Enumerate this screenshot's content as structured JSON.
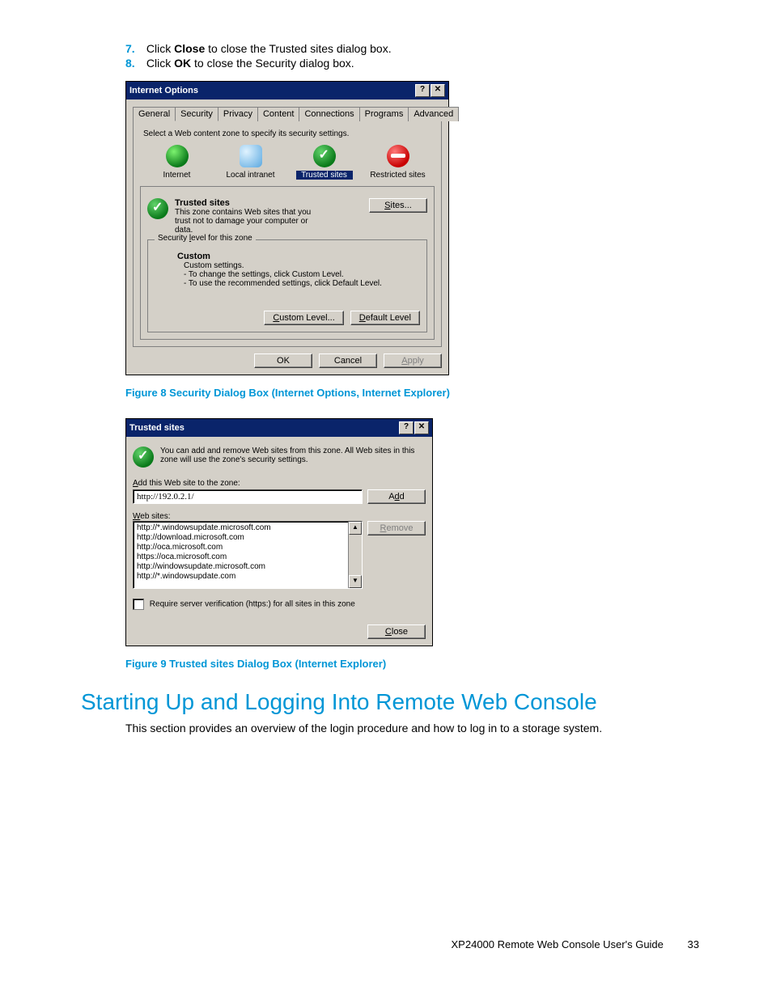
{
  "steps": [
    {
      "num": "7.",
      "pre": "Click ",
      "bold": "Close",
      "post": " to close the Trusted sites dialog box."
    },
    {
      "num": "8.",
      "pre": "Click ",
      "bold": "OK",
      "post": " to close the Security dialog box."
    }
  ],
  "dlg1": {
    "title": "Internet Options",
    "helpGlyph": "?",
    "closeGlyph": "✕",
    "tabs": [
      "General",
      "Security",
      "Privacy",
      "Content",
      "Connections",
      "Programs",
      "Advanced"
    ],
    "activeTab": 1,
    "intro": "Select a Web content zone to specify its security settings.",
    "zones": [
      {
        "label": "Internet",
        "iconClass": "globe"
      },
      {
        "label": "Local intranet",
        "iconClass": "intranet"
      },
      {
        "label": "Trusted sites",
        "iconClass": "trusted",
        "selected": true
      },
      {
        "label": "Restricted sites",
        "iconClass": "restricted"
      }
    ],
    "zoneTitle": "Trusted sites",
    "zoneDesc": "This zone contains Web sites that you trust not to damage your computer or data.",
    "sitesBtn": "Sites...",
    "secLevelLabel": "Security level for this zone",
    "custom": "Custom",
    "customSub": "Custom settings.",
    "customL1": "- To change the settings, click Custom Level.",
    "customL2": "- To use the recommended settings, click Default Level.",
    "customLevelBtn": "Custom Level...",
    "defaultLevelBtn": "Default Level",
    "okBtn": "OK",
    "cancelBtn": "Cancel",
    "applyBtn": "Apply"
  },
  "caption1": "Figure 8 Security Dialog Box (Internet Options, Internet Explorer)",
  "dlg2": {
    "title": "Trusted sites",
    "helpGlyph": "?",
    "closeGlyph": "✕",
    "intro": "You can add and remove Web sites from this zone. All Web sites in this zone will use the zone's security settings.",
    "addLabel": "Add this Web site to the zone:",
    "addValue": "http://192.0.2.1/",
    "addBtn": "Add",
    "listLabel": "Web sites:",
    "list": [
      "http://*.windowsupdate.microsoft.com",
      "http://download.microsoft.com",
      "http://oca.microsoft.com",
      "https://oca.microsoft.com",
      "http://windowsupdate.microsoft.com",
      "http://*.windowsupdate.com"
    ],
    "removeBtn": "Remove",
    "requireLabel": "Require server verification (https:) for all sites in this zone",
    "closeBtn": "Close"
  },
  "caption2": "Figure 9 Trusted sites Dialog Box (Internet Explorer)",
  "heading": "Starting Up and Logging Into Remote Web Console",
  "body1": "This section provides an overview of the login procedure and how to log in to a storage system.",
  "footer": {
    "text": "XP24000 Remote Web Console User's Guide",
    "page": "33"
  }
}
